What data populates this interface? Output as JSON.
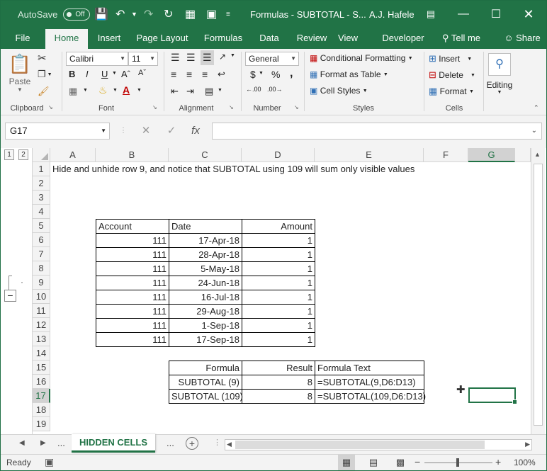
{
  "titlebar": {
    "autosave_label": "AutoSave",
    "autosave_state": "Off",
    "title": "Formulas - SUBTOTAL - S...",
    "user": "A.J. Hafele",
    "icons": [
      "save-icon",
      "undo-icon",
      "redo-icon",
      "refresh-icon",
      "sheet-icon",
      "camera-icon",
      "customize-icon",
      "ribbon-display-icon",
      "minimize-icon",
      "maximize-icon",
      "close-icon"
    ]
  },
  "tabs": [
    "File",
    "Home",
    "Insert",
    "Page Layout",
    "Formulas",
    "Data",
    "Review",
    "Developer",
    "Tell me",
    "Share"
  ],
  "active_tab": "Home",
  "ribbon": {
    "clipboard": {
      "paste": "Paste",
      "label": "Clipboard"
    },
    "font": {
      "name": "Calibri",
      "size": "11",
      "label": "Font",
      "bold": "B",
      "italic": "I",
      "underline": "U"
    },
    "alignment": {
      "label": "Alignment"
    },
    "number": {
      "format": "General",
      "currency": "$",
      "percent": "%",
      "comma": ",",
      "label": "Number"
    },
    "styles": {
      "conditional": "Conditional Formatting",
      "format_table": "Format as Table",
      "cell_styles": "Cell Styles",
      "label": "Styles"
    },
    "cells": {
      "insert": "Insert",
      "delete": "Delete",
      "format": "Format",
      "label": "Cells"
    },
    "editing": {
      "label": "Editing"
    }
  },
  "formula_bar": {
    "name_box": "G17",
    "fx": "fx",
    "formula": ""
  },
  "columns": [
    "A",
    "B",
    "C",
    "D",
    "E",
    "F",
    "G"
  ],
  "selected_column": "G",
  "rows": [
    "1",
    "2",
    "3",
    "4",
    "5",
    "6",
    "7",
    "8",
    "9",
    "10",
    "11",
    "12",
    "13",
    "14",
    "15",
    "16",
    "17",
    "18",
    "19"
  ],
  "selected_row": "17",
  "outline": {
    "levels": [
      "1",
      "2"
    ],
    "collapse": "−",
    "dot": "·"
  },
  "sheet": {
    "note": "Hide and unhide row 9, and notice that SUBTOTAL using 109 will sum only visible values",
    "table_headers": [
      "Account",
      "Date",
      "Amount"
    ],
    "table_rows": [
      [
        "111",
        "17-Apr-18",
        "1"
      ],
      [
        "111",
        "28-Apr-18",
        "1"
      ],
      [
        "111",
        "5-May-18",
        "1"
      ],
      [
        "111",
        "24-Jun-18",
        "1"
      ],
      [
        "111",
        "16-Jul-18",
        "1"
      ],
      [
        "111",
        "29-Aug-18",
        "1"
      ],
      [
        "111",
        "1-Sep-18",
        "1"
      ],
      [
        "111",
        "17-Sep-18",
        "1"
      ]
    ],
    "results_headers": [
      "Formula",
      "Result",
      "Formula Text"
    ],
    "results_rows": [
      [
        "SUBTOTAL (9)",
        "8",
        "=SUBTOTAL(9,D6:D13)"
      ],
      [
        "SUBTOTAL (109)",
        "8",
        "=SUBTOTAL(109,D6:D13)"
      ]
    ]
  },
  "sheet_tabs": {
    "active": "HIDDEN CELLS",
    "more_left": "...",
    "more_right": "..."
  },
  "status": {
    "ready": "Ready",
    "zoom": "100%"
  }
}
